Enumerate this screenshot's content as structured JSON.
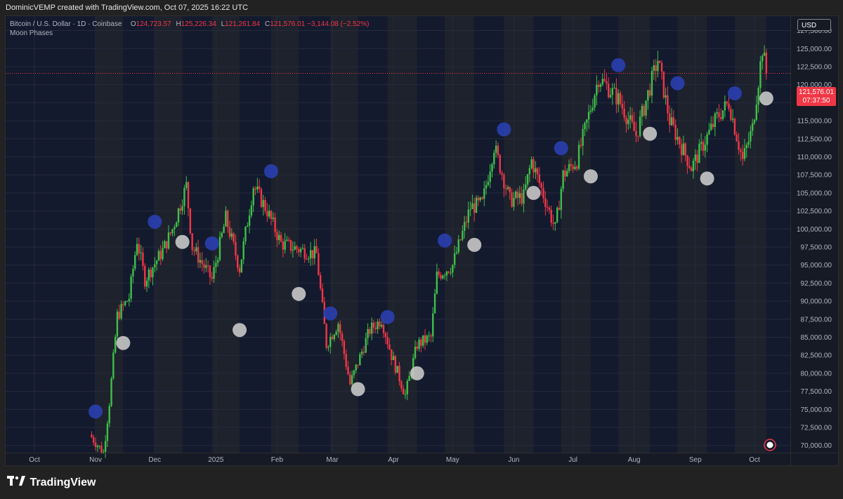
{
  "attribution": "DominicVEMP created with TradingView.com, Oct 07, 2025 16:22 UTC",
  "legend": {
    "symbol": "Bitcoin / U.S. Dollar · 1D · Coinbase",
    "o_label": "O",
    "o_value": "124,723.57",
    "h_label": "H",
    "h_value": "125,226.34",
    "l_label": "L",
    "l_value": "121,261.84",
    "c_label": "C",
    "c_value": "121,576.01",
    "change": "−3,144.08 (−2.52%)",
    "indicator": "Moon Phases"
  },
  "currency": "USD",
  "last_price_tag": {
    "price": "121,576.01",
    "countdown": "07:37:50"
  },
  "brand": "TradingView",
  "colors": {
    "up": "#26a69a",
    "up_bar": "#3fbf4a",
    "down": "#f23645",
    "full_moon": "#c8c8c8",
    "new_moon": "#2a3fb0",
    "band_dark": "#131a2e",
    "band_light": "#1e222d"
  },
  "chart_data": {
    "type": "candlestick",
    "title": "Bitcoin / U.S. Dollar · 1D · Coinbase",
    "x_tick_labels": [
      "Oct",
      "Nov",
      "Dec",
      "2025",
      "Feb",
      "Mar",
      "Apr",
      "May",
      "Jun",
      "Jul",
      "Aug",
      "Sep",
      "Oct"
    ],
    "x_tick_dates": [
      "2024-10-01",
      "2024-11-01",
      "2024-12-01",
      "2025-01-01",
      "2025-02-01",
      "2025-03-01",
      "2025-04-01",
      "2025-05-01",
      "2025-06-01",
      "2025-07-01",
      "2025-08-01",
      "2025-09-01",
      "2025-10-01"
    ],
    "y_tick_labels": [
      "70,000.00",
      "72,500.00",
      "75,000.00",
      "77,500.00",
      "80,000.00",
      "82,500.00",
      "85,000.00",
      "87,500.00",
      "90,000.00",
      "92,500.00",
      "95,000.00",
      "97,500.00",
      "100,000.00",
      "102,500.00",
      "105,000.00",
      "107,500.00",
      "110,000.00",
      "112,500.00",
      "115,000.00",
      "117,500.00",
      "120,000.00",
      "122,500.00",
      "125,000.00",
      "127,500.00"
    ],
    "ylim": [
      69000,
      129500
    ],
    "last_price": 121576.01,
    "price_path": [
      [
        "2024-10-29",
        71500
      ],
      [
        "2024-11-05",
        69000
      ],
      [
        "2024-11-08",
        76000
      ],
      [
        "2024-11-12",
        88000
      ],
      [
        "2024-11-18",
        90500
      ],
      [
        "2024-11-22",
        98500
      ],
      [
        "2024-11-26",
        93000
      ],
      [
        "2024-12-05",
        97000
      ],
      [
        "2024-12-10",
        100000
      ],
      [
        "2024-12-17",
        106000
      ],
      [
        "2024-12-20",
        97500
      ],
      [
        "2024-12-30",
        93000
      ],
      [
        "2025-01-06",
        101500
      ],
      [
        "2025-01-13",
        94500
      ],
      [
        "2025-01-20",
        106000
      ],
      [
        "2025-01-27",
        102500
      ],
      [
        "2025-02-03",
        98000
      ],
      [
        "2025-02-14",
        97000
      ],
      [
        "2025-02-21",
        96500
      ],
      [
        "2025-02-26",
        84000
      ],
      [
        "2025-03-04",
        87000
      ],
      [
        "2025-03-10",
        78500
      ],
      [
        "2025-03-20",
        86000
      ],
      [
        "2025-03-26",
        87500
      ],
      [
        "2025-03-31",
        82500
      ],
      [
        "2025-04-07",
        77000
      ],
      [
        "2025-04-13",
        84000
      ],
      [
        "2025-04-20",
        85000
      ],
      [
        "2025-04-23",
        93500
      ],
      [
        "2025-05-01",
        95000
      ],
      [
        "2025-05-10",
        103000
      ],
      [
        "2025-05-16",
        103500
      ],
      [
        "2025-05-22",
        111500
      ],
      [
        "2025-05-30",
        104000
      ],
      [
        "2025-06-06",
        104500
      ],
      [
        "2025-06-10",
        109500
      ],
      [
        "2025-06-22",
        100000
      ],
      [
        "2025-06-26",
        107500
      ],
      [
        "2025-07-03",
        109500
      ],
      [
        "2025-07-14",
        121000
      ],
      [
        "2025-07-24",
        118000
      ],
      [
        "2025-08-02",
        113000
      ],
      [
        "2025-08-13",
        123500
      ],
      [
        "2025-08-19",
        115000
      ],
      [
        "2025-08-30",
        108500
      ],
      [
        "2025-09-12",
        115500
      ],
      [
        "2025-09-18",
        117500
      ],
      [
        "2025-09-25",
        109500
      ],
      [
        "2025-09-30",
        114000
      ],
      [
        "2025-10-05",
        125000
      ],
      [
        "2025-10-07",
        121576.01
      ]
    ],
    "full_moons": [
      [
        "2024-11-15",
        84200
      ],
      [
        "2024-12-15",
        98200
      ],
      [
        "2025-01-13",
        86000
      ],
      [
        "2025-02-12",
        91000
      ],
      [
        "2025-03-14",
        77800
      ],
      [
        "2025-04-13",
        80000
      ],
      [
        "2025-05-12",
        97800
      ],
      [
        "2025-06-11",
        105000
      ],
      [
        "2025-07-10",
        107300
      ],
      [
        "2025-08-09",
        113200
      ],
      [
        "2025-09-07",
        107000
      ],
      [
        "2025-10-07",
        118100
      ]
    ],
    "new_moons": [
      [
        "2024-11-01",
        74700
      ],
      [
        "2024-12-01",
        101000
      ],
      [
        "2024-12-30",
        98000
      ],
      [
        "2025-01-29",
        108000
      ],
      [
        "2025-02-28",
        88300
      ],
      [
        "2025-03-29",
        87800
      ],
      [
        "2025-04-27",
        98400
      ],
      [
        "2025-05-27",
        113800
      ],
      [
        "2025-06-25",
        111200
      ],
      [
        "2025-07-24",
        122700
      ],
      [
        "2025-08-23",
        120200
      ],
      [
        "2025-09-21",
        118800
      ]
    ]
  }
}
